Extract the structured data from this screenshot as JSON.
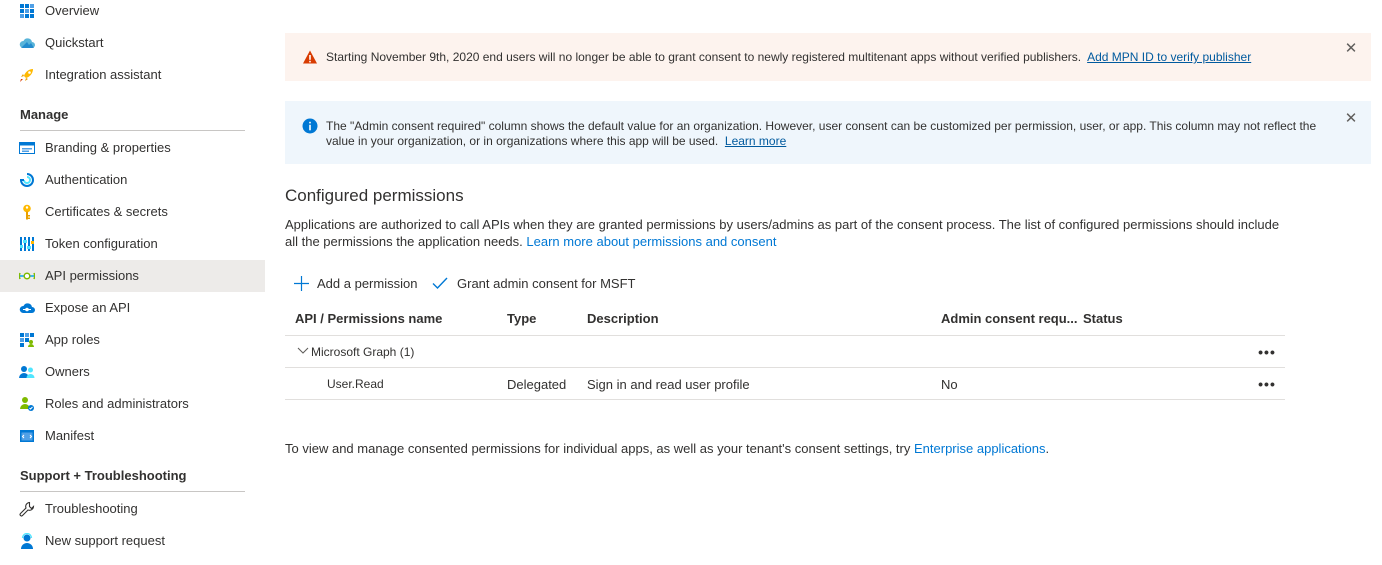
{
  "sidebar": {
    "top_items": [
      {
        "label": "Overview",
        "icon": "grid-icon"
      },
      {
        "label": "Quickstart",
        "icon": "cloud-icon"
      },
      {
        "label": "Integration assistant",
        "icon": "rocket-icon"
      }
    ],
    "manage_title": "Manage",
    "manage_items": [
      {
        "label": "Branding & properties",
        "icon": "branding-icon"
      },
      {
        "label": "Authentication",
        "icon": "authentication-icon"
      },
      {
        "label": "Certificates & secrets",
        "icon": "key-icon"
      },
      {
        "label": "Token configuration",
        "icon": "token-bars-icon"
      },
      {
        "label": "API permissions",
        "icon": "api-icon",
        "selected": true
      },
      {
        "label": "Expose an API",
        "icon": "cloud-api-icon"
      },
      {
        "label": "App roles",
        "icon": "app-roles-icon"
      },
      {
        "label": "Owners",
        "icon": "owners-icon"
      },
      {
        "label": "Roles and administrators",
        "icon": "roles-icon"
      },
      {
        "label": "Manifest",
        "icon": "manifest-icon"
      }
    ],
    "support_title": "Support + Troubleshooting",
    "support_items": [
      {
        "label": "Troubleshooting",
        "icon": "wrench-icon"
      },
      {
        "label": "New support request",
        "icon": "support-person-icon"
      }
    ]
  },
  "warning_banner": {
    "text": "Starting November 9th, 2020 end users will no longer be able to grant consent to newly registered multitenant apps without verified publishers.",
    "link": "Add MPN ID to verify publisher",
    "close": "✕"
  },
  "info_banner": {
    "text": "The \"Admin consent required\" column shows the default value for an organization. However, user consent can be customized per permission, user, or app. This column may not reflect the value in your organization, or in organizations where this app will be used.",
    "link": "Learn more",
    "close": "✕"
  },
  "section": {
    "title": "Configured permissions",
    "description": "Applications are authorized to call APIs when they are granted permissions by users/admins as part of the consent process. The list of configured permissions should include all the permissions the application needs.",
    "learn_more": "Learn more about permissions and consent"
  },
  "commands": {
    "add": "Add a permission",
    "grant": "Grant admin consent for MSFT"
  },
  "table": {
    "headers": [
      "API / Permissions name",
      "Type",
      "Description",
      "Admin consent requ...",
      "Status"
    ],
    "group": {
      "label": "Microsoft Graph (1)",
      "more": "•••"
    },
    "rows": [
      {
        "name": "User.Read",
        "type": "Delegated",
        "description": "Sign in and read user profile",
        "admin_consent": "No",
        "status": "",
        "more": "•••"
      }
    ]
  },
  "footer": {
    "text": "To view and manage consented permissions for individual apps, as well as your tenant's consent settings, try",
    "link": "Enterprise applications",
    "end": "."
  },
  "colors": {
    "accent": "#0078d4",
    "warning_bg": "#fdf3ee",
    "info_bg": "#eff6fc",
    "warning_icon": "#d83b01",
    "selected_bg": "#edebe9"
  }
}
